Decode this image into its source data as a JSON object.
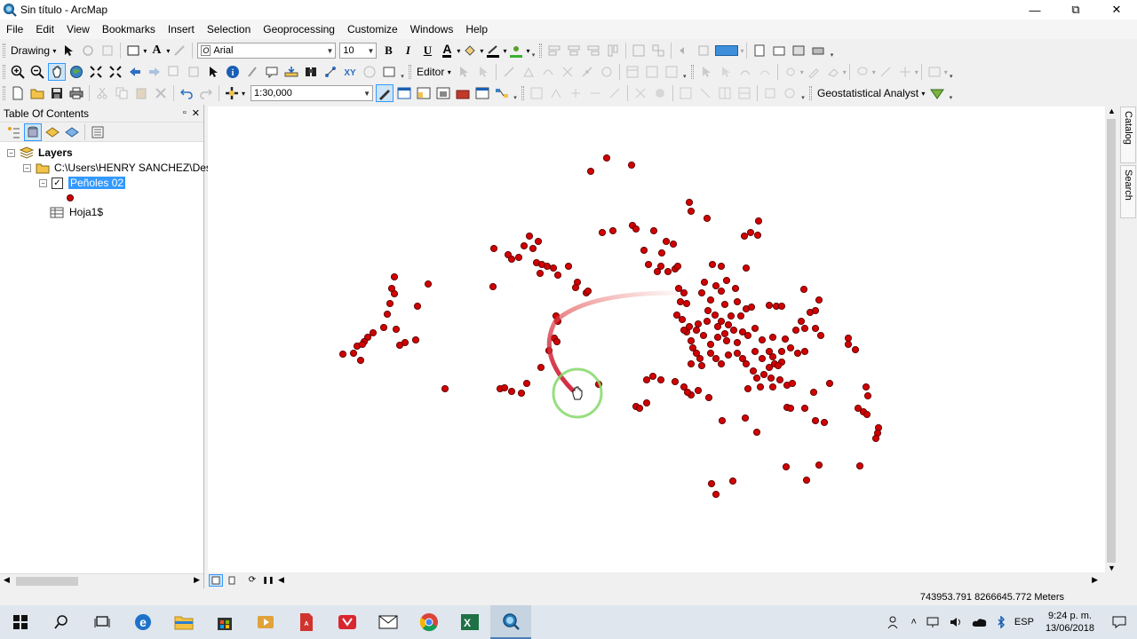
{
  "window": {
    "title": "Sin título - ArcMap",
    "minimize": "—",
    "maximize": "⧉",
    "close": "✕"
  },
  "menu": [
    "File",
    "Edit",
    "View",
    "Bookmarks",
    "Insert",
    "Selection",
    "Geoprocessing",
    "Customize",
    "Windows",
    "Help"
  ],
  "drawing_toolbar": {
    "drawing_label": "Drawing",
    "font": "Arial",
    "font_size": "10",
    "bold": "B",
    "italic": "I",
    "underline": "U",
    "text_tool": "A",
    "font_color": "A"
  },
  "tools_toolbar": {
    "editor_label": "Editor"
  },
  "standard_toolbar": {
    "scale": "1:30,000",
    "geostatistical_label": "Geostatistical Analyst"
  },
  "toc": {
    "title": "Table Of Contents",
    "pin": "📌",
    "close": "✕",
    "layers_label": "Layers",
    "data_path": "C:\\Users\\HENRY SANCHEZ\\Deskt",
    "layer_name": "Peñoles 02",
    "table_name": "Hoja1$"
  },
  "side_tabs": [
    "Catalog",
    "Search"
  ],
  "status": {
    "coordinates": "743953.791  8266645.772 Meters"
  },
  "taskbar": {
    "language": "ESP",
    "time": "9:24 p. m.",
    "date": "13/06/2018"
  },
  "colors": {
    "point_fill": "#d00000",
    "point_stroke": "#5a0000",
    "selection": "#3399ff",
    "cursor_ring": "#86d86a"
  }
}
